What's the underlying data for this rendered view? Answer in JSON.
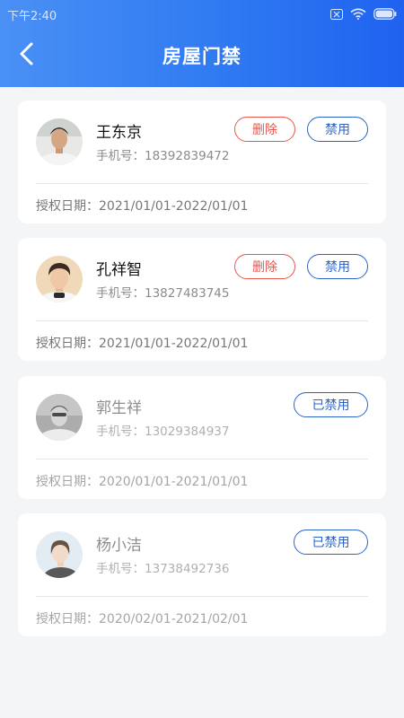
{
  "status_bar": {
    "time": "下午2:40",
    "icons": [
      "notification-x-icon",
      "wifi-icon",
      "battery-icon"
    ]
  },
  "header": {
    "title": "房屋门禁",
    "back_icon": "chevron-left-icon"
  },
  "colors": {
    "header_gradient_start": "#4a90f5",
    "header_gradient_end": "#1f62ef",
    "delete_red": "#e8554e",
    "ban_blue": "#2c63c8"
  },
  "members": [
    {
      "name": "王东京",
      "phone": "手机号：18392839472",
      "auth_date": "授权日期：2021/01/01-2022/01/01",
      "delete_label": "删除",
      "ban_label": "禁用",
      "disabled": false
    },
    {
      "name": "孔祥智",
      "phone": "手机号：13827483745",
      "auth_date": "授权日期：2021/01/01-2022/01/01",
      "delete_label": "删除",
      "ban_label": "禁用",
      "disabled": false
    },
    {
      "name": "郭生祥",
      "phone": "手机号：13029384937",
      "auth_date": "授权日期：2020/01/01-2021/01/01",
      "status_label": "已禁用",
      "disabled": true
    },
    {
      "name": "杨小洁",
      "phone": "手机号：13738492736",
      "auth_date": "授权日期：2020/02/01-2021/02/01",
      "status_label": "已禁用",
      "disabled": true
    }
  ]
}
